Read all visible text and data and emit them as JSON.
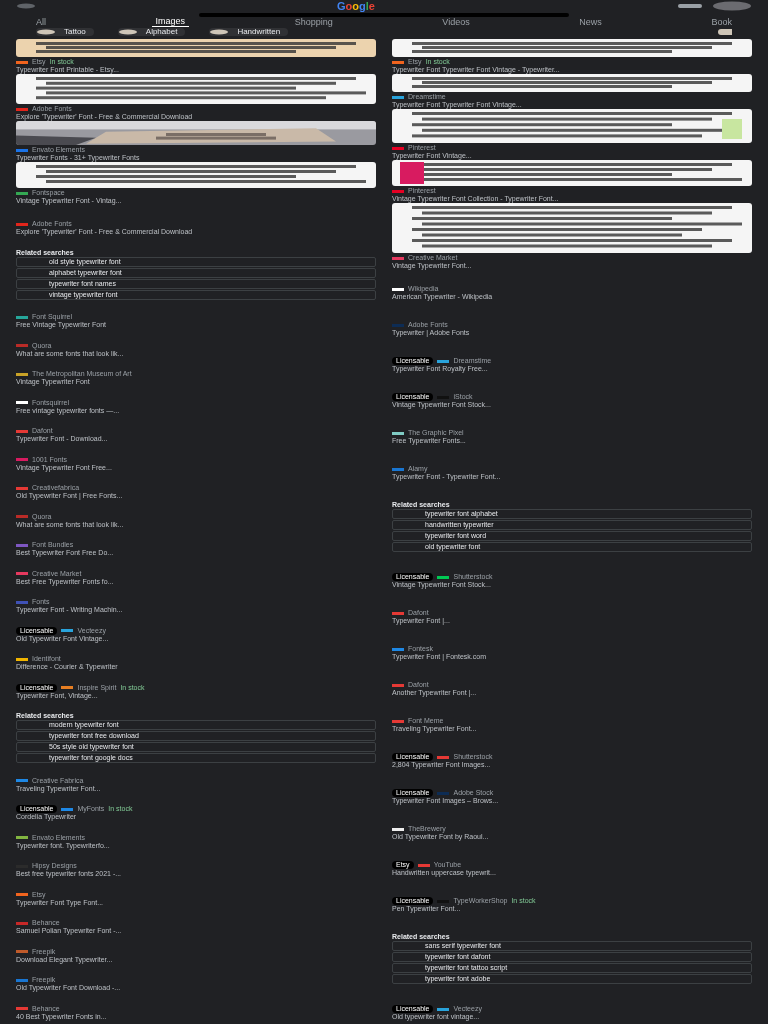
{
  "header": {
    "logo": "Google"
  },
  "tabs": [
    {
      "label": "All",
      "selected": false
    },
    {
      "label": "Images",
      "selected": true
    },
    {
      "label": "Shopping",
      "selected": false
    },
    {
      "label": "Videos",
      "selected": false
    },
    {
      "label": "News",
      "selected": false
    },
    {
      "label": "Book",
      "selected": false
    }
  ],
  "chips": [
    {
      "label": "Tattoo"
    },
    {
      "label": "Alphabet"
    },
    {
      "label": "Handwritten"
    }
  ],
  "columns": [
    {
      "images": [
        {
          "source": "Etsy",
          "stock": "In stock",
          "title": "Typewriter Font Printable - Etsy...",
          "color": "#f1641e"
        },
        {
          "source": "Adobe Fonts",
          "title": "Explore 'Typewriter' Font - Free & Commercial Download",
          "color": "#e1251b"
        },
        {
          "source": "Envato Elements",
          "title": "Typewriter Fonts - 31+ Typewriter Fonts",
          "color": "#1a73e8"
        },
        {
          "source": "Fontspace",
          "title": "Vintage Typewriter Font - Vintag...",
          "color": "#34a853"
        }
      ],
      "sections": [
        {
          "kind": "result",
          "source": "Adobe Fonts",
          "title": "Explore 'Typewriter' Font - Free & Commercial Download",
          "color": "#e1251b"
        },
        {
          "kind": "related",
          "heading": "Related searches",
          "items": [
            "old style typewriter font",
            "alphabet typewriter font",
            "typewriter font names",
            "vintage typewriter font"
          ]
        },
        {
          "kind": "result",
          "source": "Font Squirrel",
          "title": "Free Vintage Typewriter Font",
          "color": "#26a69a"
        },
        {
          "kind": "result",
          "source": "Quora",
          "title": "What are some fonts that look lik...",
          "color": "#b92b27"
        },
        {
          "kind": "result",
          "source": "The Metropolitan Museum of Art",
          "title": "Vintage Typewriter Font",
          "color": "#c9a227"
        },
        {
          "kind": "result",
          "source": "Fontsquirrel",
          "title": "Free vintage typewriter fonts —...",
          "color": "#ffffff"
        },
        {
          "kind": "result",
          "source": "Dafont",
          "title": "Typewriter Font - Download...",
          "color": "#e53935"
        },
        {
          "kind": "result",
          "source": "1001 Fonts",
          "title": "Vintage Typewriter Font Free...",
          "color": "#d81b60"
        },
        {
          "kind": "result",
          "source": "Creativefabrica",
          "title": "Old Typewriter Font | Free Fonts...",
          "color": "#e53935"
        },
        {
          "kind": "result",
          "source": "Quora",
          "title": "What are some fonts that look lik...",
          "color": "#b92b27"
        },
        {
          "kind": "result",
          "source": "Font Bundles",
          "title": "Best Typewriter Font Free Do...",
          "color": "#7e57c2"
        },
        {
          "kind": "result",
          "source": "Creative Market",
          "title": "Best Free Typewriter Fonts fo...",
          "color": "#e5395f"
        },
        {
          "kind": "result",
          "source": "Fonts",
          "title": "Typewriter Font - Writing Machin...",
          "color": "#3f51b5"
        },
        {
          "kind": "result",
          "badge": "Licensable",
          "source": "Vecteezy",
          "title": "Old Typewriter Font Vintage...",
          "color": "#29a3db"
        },
        {
          "kind": "result",
          "source": "Identifont",
          "title": "Difference - Courier & Typewriter",
          "color": "#f0b400"
        },
        {
          "kind": "result",
          "badge": "Licensable",
          "source": "Inspire Spirit",
          "stock": "In stock",
          "title": "Typewriter Font, Vintage...",
          "color": "#e67e22"
        },
        {
          "kind": "related",
          "heading": "Related searches",
          "items": [
            "modern typewriter font",
            "typewriter font free download",
            "50s style old typewriter font",
            "typewriter font google docs"
          ]
        },
        {
          "kind": "result",
          "source": "Creative Fabrica",
          "title": "Traveling Typewriter Font...",
          "color": "#1e88e5"
        },
        {
          "kind": "result",
          "badge": "Licensable",
          "source": "MyFonts",
          "stock": "In stock",
          "title": "Cordelia Typewriter",
          "color": "#1e88e5"
        },
        {
          "kind": "result",
          "source": "Envato Elements",
          "title": "Typewriter font. Typewriterfo...",
          "color": "#82b541"
        },
        {
          "kind": "result",
          "source": "Hipsy Designs",
          "title": "Best free typewriter fonts 2021 -...",
          "color": "#2b2b2b"
        },
        {
          "kind": "result",
          "source": "Etsy",
          "title": "Typewriter Font Type Font...",
          "color": "#f1641e"
        },
        {
          "kind": "result",
          "source": "Behance",
          "title": "Samuel Polian Typewriter Font -...",
          "color": "#c62828"
        },
        {
          "kind": "result",
          "source": "Freepik",
          "title": "Download Elegant Typewriter...",
          "color": "#bf5a2a"
        },
        {
          "kind": "result",
          "source": "Freepik",
          "title": "Old Typewriter Font Download -...",
          "color": "#1976d2"
        },
        {
          "kind": "result",
          "source": "Behance",
          "title": "40 Best Typewriter Fonts in...",
          "color": "#e53935"
        }
      ]
    },
    {
      "images": [
        {
          "source": "Etsy",
          "stock": "In stock",
          "title": "Typewriter Font Typewriter Font Vintage - Typewriter...",
          "color": "#f1641e"
        },
        {
          "source": "Dreamstime",
          "title": "Typewriter Font Typewriter Font Vintage...",
          "color": "#29a3db"
        },
        {
          "source": "Pinterest",
          "title": "Typewriter Font Vintage...",
          "color": "#e60023"
        },
        {
          "source": "Pinterest",
          "title": "Vintage Typewriter Font Collection - Typewriter Font...",
          "color": "#e60023"
        },
        {
          "source": "Creative Market",
          "title": "Vintage Typewriter Font...",
          "color": "#e5395f"
        }
      ],
      "sections": [
        {
          "kind": "result",
          "source": "Wikipedia",
          "title": "American Typewriter - Wikipedia",
          "color": "#ffffff"
        },
        {
          "kind": "result",
          "source": "Adobe Fonts",
          "title": "Typewriter | Adobe Fonts",
          "color": "#0d2c54"
        },
        {
          "kind": "result",
          "badge": "Licensable",
          "source": "Dreamstime",
          "title": "Typewriter Font Royalty Free...",
          "color": "#29a3db"
        },
        {
          "kind": "result",
          "badge": "Licensable",
          "source": "iStock",
          "title": "Vintage Typewriter Font Stock...",
          "color": "#111111"
        },
        {
          "kind": "result",
          "source": "The Graphic Pixel",
          "title": "Free Typewriter Fonts...",
          "color": "#80cbc4"
        },
        {
          "kind": "result",
          "source": "Alamy",
          "title": "Typewriter Font - Typewriter Font...",
          "color": "#1976d2"
        },
        {
          "kind": "related",
          "heading": "Related searches",
          "items": [
            "typewriter font alphabet",
            "handwritten typewriter",
            "typewriter font word",
            "old typewriter font"
          ]
        },
        {
          "kind": "result",
          "badge": "Licensable",
          "source": "Shutterstock",
          "title": "Vintage Typewriter Font Stock...",
          "color": "#00c853"
        },
        {
          "kind": "result",
          "source": "Dafont",
          "title": "Typewriter Font |...",
          "color": "#e53935"
        },
        {
          "kind": "result",
          "source": "Fontesk",
          "title": "Typewriter Font | Fontesk.com",
          "color": "#1e88e5"
        },
        {
          "kind": "result",
          "source": "Dafont",
          "title": "Another Typewriter Font |...",
          "color": "#e53935"
        },
        {
          "kind": "result",
          "source": "Font Meme",
          "title": "Traveling Typewriter Font...",
          "color": "#e53935"
        },
        {
          "kind": "result",
          "badge": "Licensable",
          "source": "Shutterstock",
          "title": "2,804 Typewriter Font Images...",
          "color": "#e53935"
        },
        {
          "kind": "result",
          "badge": "Licensable",
          "source": "Adobe Stock",
          "title": "Typewriter Font Images – Brows...",
          "color": "#0d2c54"
        },
        {
          "kind": "result",
          "source": "TheBrewery",
          "title": "Old Typewriter Font by Raoul...",
          "color": "#eeeeee"
        },
        {
          "kind": "result",
          "badge": "Etsy",
          "source": "YouTube",
          "title": "Handwritten uppercase typewrit...",
          "color": "#e53935"
        },
        {
          "kind": "result",
          "badge": "Licensable",
          "source": "TypeWorkerShop",
          "stock": "In stock",
          "title": "Pen Typewriter Font...",
          "color": "#111111"
        },
        {
          "kind": "related",
          "heading": "Related searches",
          "items": [
            "sans serif typewriter font",
            "typewriter font dafont",
            "typewriter font tattoo script",
            "typewriter font adobe"
          ]
        },
        {
          "kind": "result",
          "badge": "Licensable",
          "source": "Vecteezy",
          "title": "Old typewriter font vintage...",
          "color": "#29a3db"
        }
      ]
    }
  ]
}
